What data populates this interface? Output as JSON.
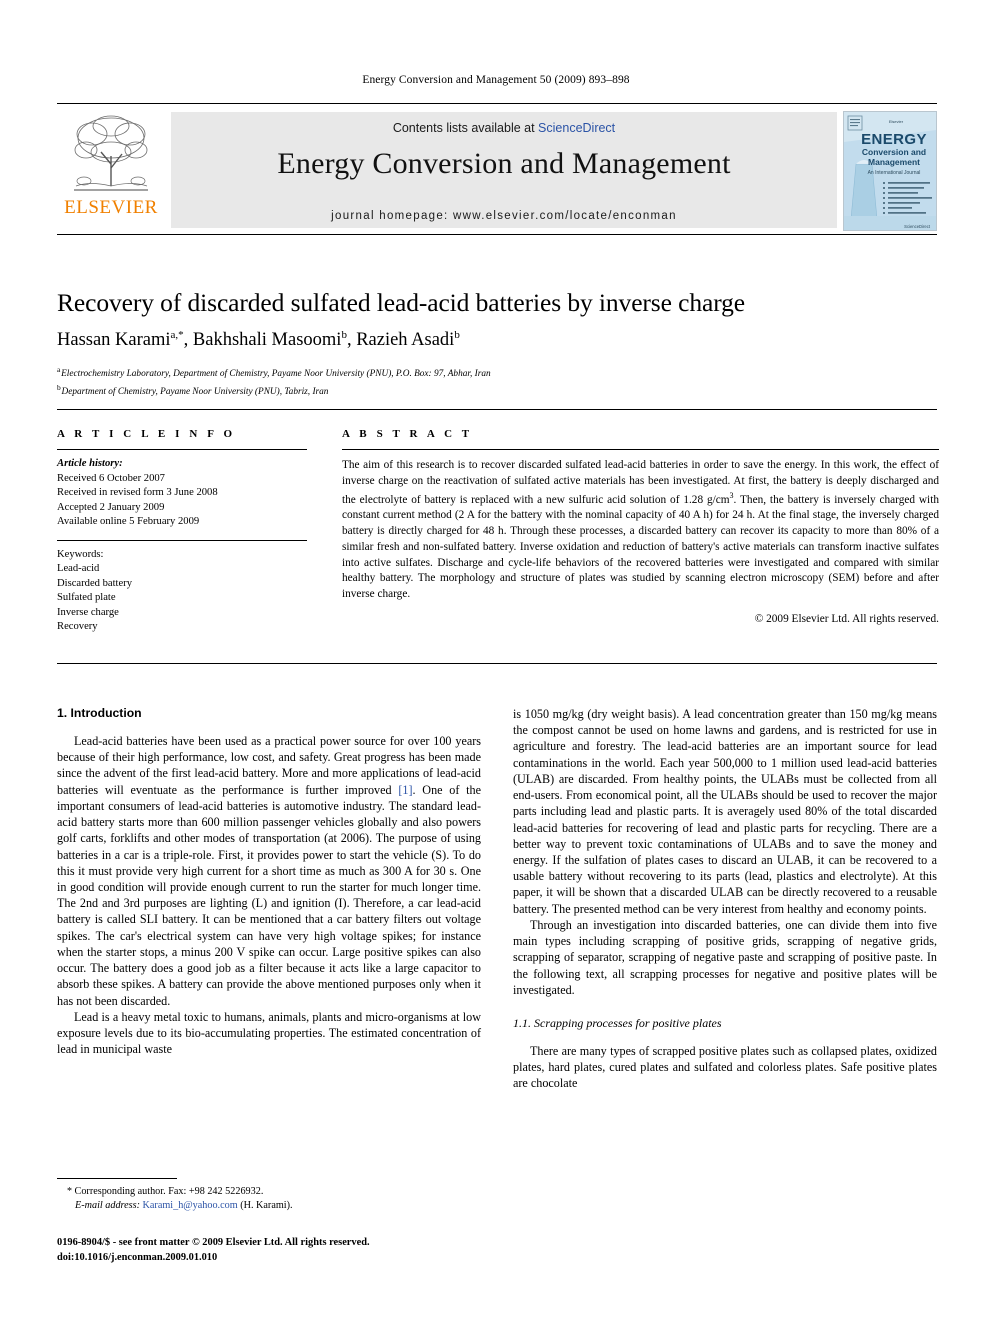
{
  "running_head": "Energy Conversion and Management 50 (2009) 893–898",
  "masthead": {
    "contents_prefix": "Contents lists available at ",
    "sciencedirect": "ScienceDirect",
    "journal_title": "Energy Conversion and Management",
    "homepage": "journal homepage: www.elsevier.com/locate/enconman",
    "publisher": "ELSEVIER",
    "accent_orange": "#F08000",
    "link_blue": "#2b53a6",
    "banner_bg": "#e8e8e8",
    "cover": {
      "kicker": "Elsevier",
      "line1": "ENERGY",
      "line2": "Conversion and",
      "line3": "Management",
      "subtitle": "An International Journal",
      "footer_mark": "ScienceDirect"
    }
  },
  "article": {
    "title": "Recovery of discarded sulfated lead-acid batteries by inverse charge",
    "authors": "Hassan Karami a,*, Bakhshali Masoomi b, Razieh Asadi b",
    "affiliations": [
      "a Electrochemistry Laboratory, Department of Chemistry, Payame Noor University (PNU), P.O. Box: 97, Abhar, Iran",
      "b Department of Chemistry, Payame Noor University (PNU), Tabriz, Iran"
    ]
  },
  "info": {
    "heading": "A R T I C L E    I N F O",
    "history_label": "Article history:",
    "history": [
      "Received 6 October 2007",
      "Received in revised form 3 June 2008",
      "Accepted 2 January 2009",
      "Available online 5 February 2009"
    ],
    "keywords_label": "Keywords:",
    "keywords": [
      "Lead-acid",
      "Discarded battery",
      "Sulfated plate",
      "Inverse charge",
      "Recovery"
    ]
  },
  "abstract": {
    "heading": "A B S T R A C T",
    "text_part1": "The aim of this research is to recover discarded sulfated lead-acid batteries in order to save the energy. In this work, the effect of inverse charge on the reactivation of sulfated active materials has been investigated. At first, the battery is deeply discharged and the electrolyte of battery is replaced with a new sulfuric acid solution of 1.28 g/cm",
    "superscript": "3",
    "text_part2": ". Then, the battery is inversely charged with constant current method (2 A for the battery with the nominal capacity of 40 A h) for 24 h. At the final stage, the inversely charged battery is directly charged for 48 h. Through these processes, a discarded battery can recover its capacity to more than 80% of a similar fresh and non-sulfated battery. Inverse oxidation and reduction of battery's active materials can transform inactive sulfates into active sulfates. Discharge and cycle-life behaviors of the recovered batteries were investigated and compared with similar healthy battery. The morphology and structure of plates was studied by scanning electron microscopy (SEM) before and after inverse charge.",
    "copyright": "© 2009 Elsevier Ltd. All rights reserved."
  },
  "body": {
    "section1_heading": "1. Introduction",
    "left_paragraphs": [
      {
        "pre": "Lead-acid batteries have been used as a practical power source for over 100 years because of their high performance, low cost, and safety. Great progress has been made since the advent of the first lead-acid battery. More and more applications of lead-acid batteries will eventuate as the performance is further improved ",
        "ref": "[1]",
        "post": ". One of the important consumers of lead-acid batteries is automotive industry. The standard lead-acid battery starts more than 600 million passenger vehicles globally and also powers golf carts, forklifts and other modes of transportation (at 2006). The purpose of using batteries in a car is a triple-role. First, it provides power to start the vehicle (S). To do this it must provide very high current for a short time as much as 300 A for 30 s. One in good condition will provide enough current to run the starter for much longer time. The 2nd and 3rd purposes are lighting (L) and ignition (I). Therefore, a car lead-acid battery is called SLI battery. It can be mentioned that a car battery filters out voltage spikes. The car's electrical system can have very high voltage spikes; for instance when the starter stops, a minus 200 V spike can occur. Large positive spikes can also occur. The battery does a good job as a filter because it acts like a large capacitor to absorb these spikes. A battery can provide the above mentioned purposes only when it has not been discarded."
      },
      {
        "pre": "Lead is a heavy metal toxic to humans, animals, plants and micro-organisms at low exposure levels due to its bio-accumulating properties. The estimated concentration of lead in municipal waste",
        "ref": "",
        "post": ""
      }
    ],
    "right_paragraphs": [
      "is 1050 mg/kg (dry weight basis). A lead concentration greater than 150 mg/kg means the compost cannot be used on home lawns and gardens, and is restricted for use in agriculture and forestry. The lead-acid batteries are an important source for lead contaminations in the world. Each year 500,000 to 1 million used lead-acid batteries (ULAB) are discarded. From healthy points, the ULABs must be collected from all end-users. From economical point, all the ULABs should be used to recover the major parts including lead and plastic parts. It is averagely used 80% of the total discarded lead-acid batteries for recovering of lead and plastic parts for recycling. There are a better way to prevent toxic contaminations of ULABs and to save the money and energy. If the sulfation of plates cases to discard an ULAB, it can be recovered to a usable battery without recovering to its parts (lead, plastics and electrolyte). At this paper, it will be shown that a discarded ULAB can be directly recovered to a reusable battery. The presented method can be very interest from healthy and economy points.",
      "Through an investigation into discarded batteries, one can divide them into five main types including scrapping of positive grids, scrapping of negative grids, scrapping of separator, scrapping of negative paste and scrapping of positive paste. In the following text, all scrapping processes for negative and positive plates will be investigated."
    ],
    "section11_heading": "1.1. Scrapping processes for positive plates",
    "right_paragraph_after": "There are many types of scrapped positive plates such as collapsed plates, oxidized plates, hard plates, cured plates and sulfated and colorless plates. Safe positive plates are chocolate"
  },
  "footnote": {
    "star": "*",
    "corresponding": "Corresponding author. Fax: +98 242 5226932.",
    "email_label": "E-mail address:",
    "email": "Karami_h@yahoo.com",
    "email_owner": "(H. Karami)."
  },
  "footer": {
    "line1": "0196-8904/$ - see front matter © 2009 Elsevier Ltd. All rights reserved.",
    "line2": "doi:10.1016/j.enconman.2009.01.010"
  }
}
